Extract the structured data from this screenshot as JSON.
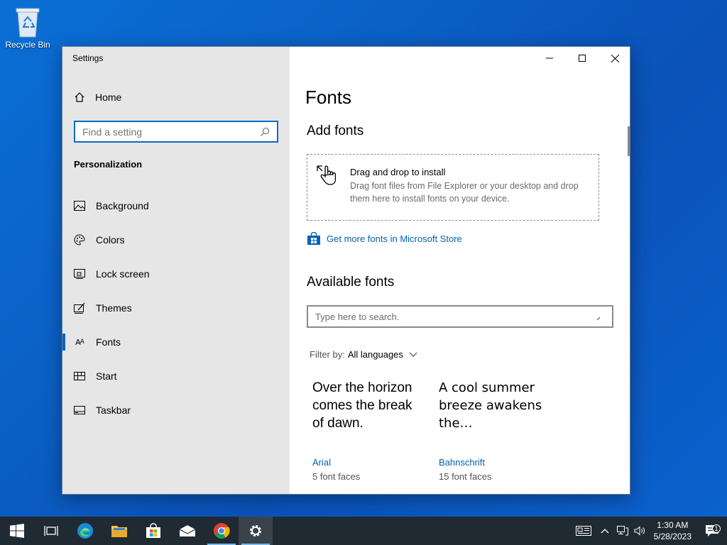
{
  "desktop": {
    "recycle_bin_label": "Recycle Bin"
  },
  "window": {
    "title": "Settings",
    "sidebar": {
      "home_label": "Home",
      "search_placeholder": "Find a setting",
      "section_title": "Personalization",
      "items": [
        {
          "label": "Background",
          "icon": "background-icon"
        },
        {
          "label": "Colors",
          "icon": "palette-icon"
        },
        {
          "label": "Lock screen",
          "icon": "lock-screen-icon"
        },
        {
          "label": "Themes",
          "icon": "themes-icon"
        },
        {
          "label": "Fonts",
          "icon": "fonts-icon",
          "active": true
        },
        {
          "label": "Start",
          "icon": "start-icon"
        },
        {
          "label": "Taskbar",
          "icon": "taskbar-icon"
        }
      ]
    },
    "content": {
      "page_title": "Fonts",
      "add_fonts_heading": "Add fonts",
      "drop_title": "Drag and drop to install",
      "drop_desc": "Drag font files from File Explorer or your desktop and drop them here to install fonts on your device.",
      "store_link": "Get more fonts in Microsoft Store",
      "available_heading": "Available fonts",
      "search_placeholder": "Type here to search.",
      "filter_label": "Filter by:",
      "filter_value": "All languages",
      "fonts": [
        {
          "sample": "Over the horizon comes the break of dawn.",
          "name": "Arial",
          "faces": "5 font faces"
        },
        {
          "sample": "A cool summer breeze awakens the…",
          "name": "Bahnschrift",
          "faces": "15 font faces"
        }
      ]
    }
  },
  "taskbar": {
    "clock_time": "1:30 AM",
    "clock_date": "5/28/2023",
    "notification_count": "1"
  },
  "colors": {
    "accent": "#0067c0",
    "link": "#0063b1",
    "sidebar_bg": "#e6e6e6",
    "taskbar_bg": "#202a33"
  }
}
